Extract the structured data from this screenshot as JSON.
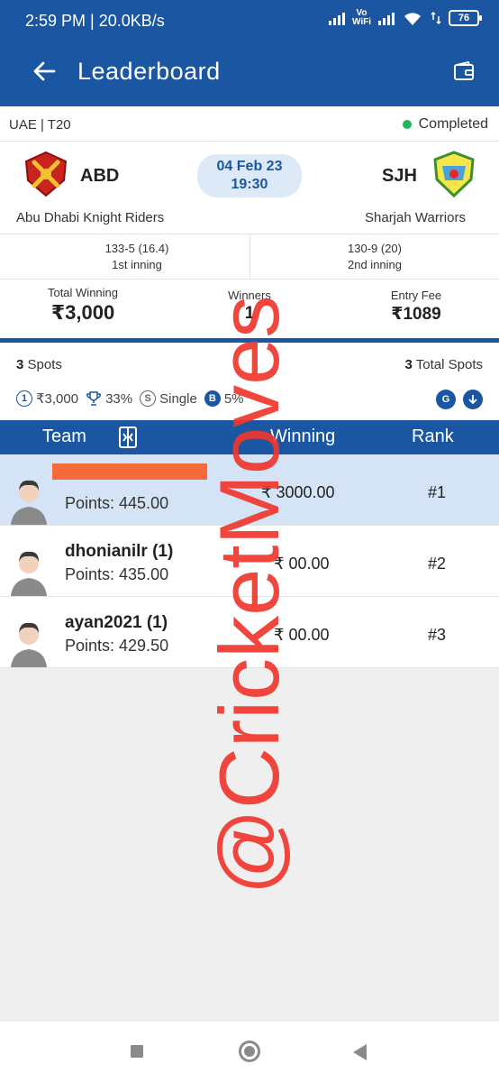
{
  "status_bar": {
    "time": "2:59 PM | 20.0KB/s",
    "vowifi_top": "Vo",
    "vowifi_bottom": "WiFi",
    "battery": "76"
  },
  "app_bar": {
    "title": "Leaderboard"
  },
  "match": {
    "league": "UAE | T20",
    "status": "Completed",
    "date": "04 Feb 23",
    "time": "19:30",
    "home": {
      "abbr": "ABD",
      "name": "Abu Dhabi Knight Riders",
      "score": "133-5 (16.4)",
      "inning": "1st inning"
    },
    "away": {
      "abbr": "SJH",
      "name": "Sharjah Warriors",
      "score": "130-9 (20)",
      "inning": "2nd inning"
    }
  },
  "contest": {
    "total_winning_label": "Total Winning",
    "total_winning": "₹3,000",
    "winners_label": "Winners",
    "winners": "1",
    "entry_fee_label": "Entry Fee",
    "entry_fee": "₹1089"
  },
  "spots": {
    "left_count": "3",
    "left_label": "Spots",
    "right_count": "3",
    "right_label": "Total Spots",
    "chips": {
      "prize": "₹3,000",
      "percent": "33%",
      "type": "Single",
      "bonus": "5%"
    },
    "badge_one": "1",
    "badge_s": "S",
    "badge_b": "B",
    "btn_g": "G"
  },
  "table": {
    "headers": {
      "team": "Team",
      "winning": "Winning",
      "rank": "Rank"
    },
    "rows": [
      {
        "name": "",
        "points": "Points: 445.00",
        "winning": "₹ 3000.00",
        "rank": "#1"
      },
      {
        "name": "dhonianilr (1)",
        "points": "Points: 435.00",
        "winning": "₹ 00.00",
        "rank": "#2"
      },
      {
        "name": "ayan2021 (1)",
        "points": "Points: 429.50",
        "winning": "₹ 00.00",
        "rank": "#3"
      }
    ]
  },
  "watermark": "@CricketMoves",
  "colors": {
    "primary": "#1b56a3",
    "highlight_row": "#d5e3f7",
    "completed_dot": "#1fb55c",
    "watermark": "#f0372e"
  }
}
